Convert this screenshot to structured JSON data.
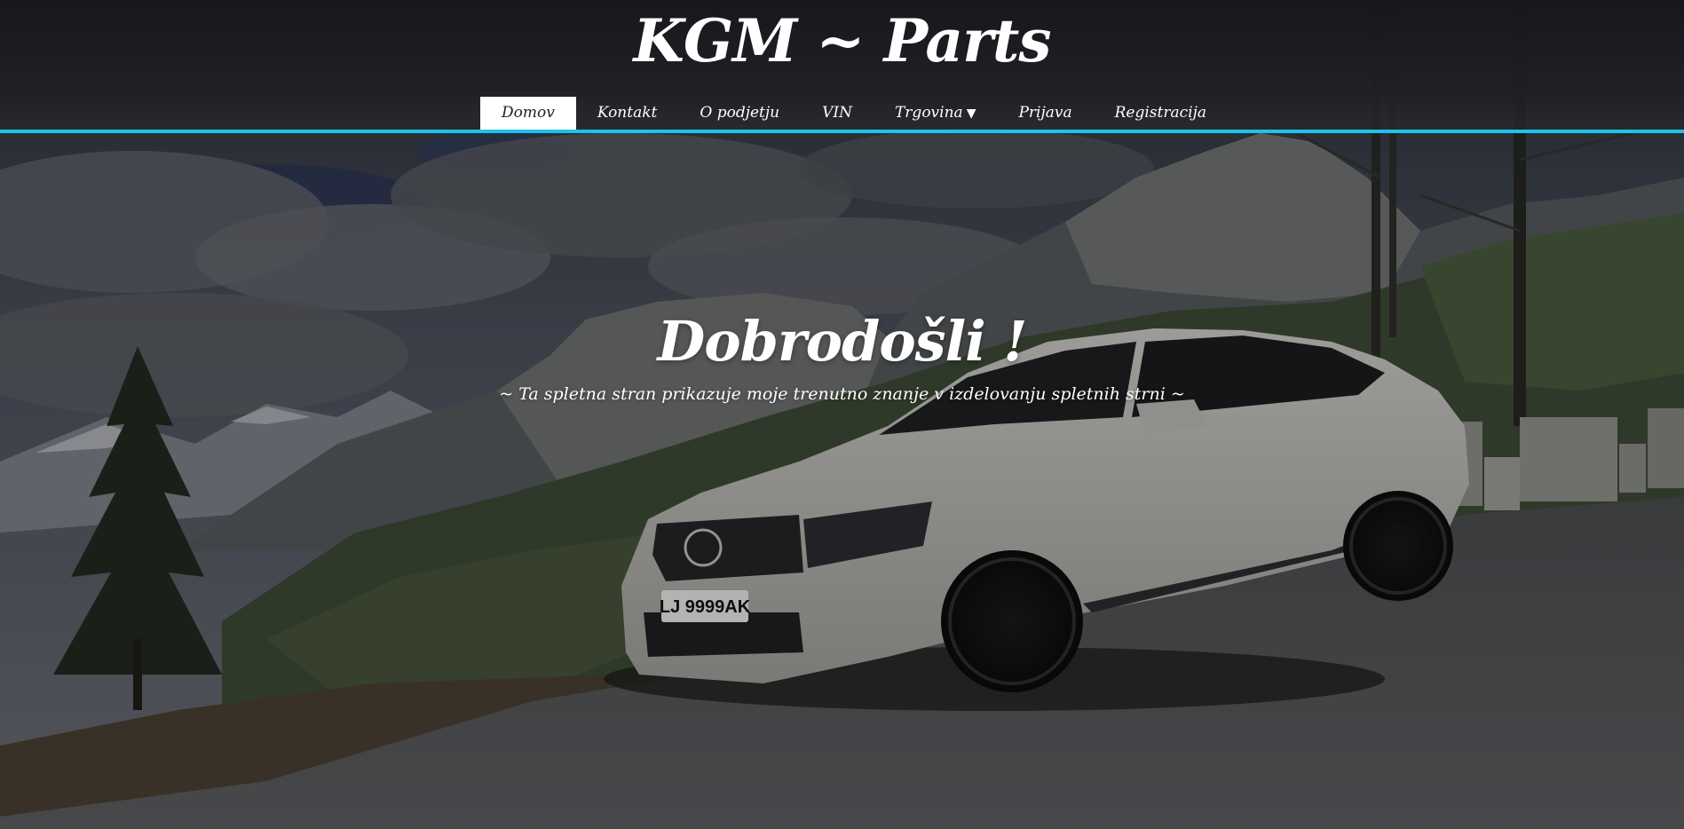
{
  "header": {
    "site_title": "KGM ~ Parts"
  },
  "nav": {
    "items": [
      {
        "label": "Domov",
        "active": true
      },
      {
        "label": "Kontakt",
        "active": false
      },
      {
        "label": "O podjetju",
        "active": false
      },
      {
        "label": "VIN",
        "active": false
      },
      {
        "label": "Trgovina",
        "active": false,
        "has_dropdown": true,
        "caret": "▼"
      },
      {
        "label": "Prijava",
        "active": false
      },
      {
        "label": "Registracija",
        "active": false
      }
    ]
  },
  "hero": {
    "title": "Dobrodošli !",
    "subtitle": "~ Ta spletna stran prikazuje moje trenutno znanje v izdelovanju spletnih strni ~",
    "license_plate": "LJ 9999AK"
  },
  "colors": {
    "accent": "#1ec3e8",
    "header_bg": "#16171b",
    "nav_active_bg": "#ffffff",
    "text": "#ffffff"
  },
  "icons": {
    "dropdown": "caret-down-icon"
  }
}
